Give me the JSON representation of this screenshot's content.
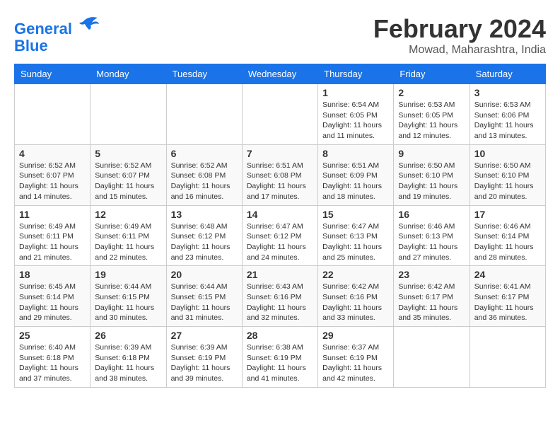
{
  "logo": {
    "line1": "General",
    "line2": "Blue"
  },
  "title": "February 2024",
  "location": "Mowad, Maharashtra, India",
  "headers": [
    "Sunday",
    "Monday",
    "Tuesday",
    "Wednesday",
    "Thursday",
    "Friday",
    "Saturday"
  ],
  "weeks": [
    [
      {
        "day": "",
        "info": ""
      },
      {
        "day": "",
        "info": ""
      },
      {
        "day": "",
        "info": ""
      },
      {
        "day": "",
        "info": ""
      },
      {
        "day": "1",
        "info": "Sunrise: 6:54 AM\nSunset: 6:05 PM\nDaylight: 11 hours and 11 minutes."
      },
      {
        "day": "2",
        "info": "Sunrise: 6:53 AM\nSunset: 6:05 PM\nDaylight: 11 hours and 12 minutes."
      },
      {
        "day": "3",
        "info": "Sunrise: 6:53 AM\nSunset: 6:06 PM\nDaylight: 11 hours and 13 minutes."
      }
    ],
    [
      {
        "day": "4",
        "info": "Sunrise: 6:52 AM\nSunset: 6:07 PM\nDaylight: 11 hours and 14 minutes."
      },
      {
        "day": "5",
        "info": "Sunrise: 6:52 AM\nSunset: 6:07 PM\nDaylight: 11 hours and 15 minutes."
      },
      {
        "day": "6",
        "info": "Sunrise: 6:52 AM\nSunset: 6:08 PM\nDaylight: 11 hours and 16 minutes."
      },
      {
        "day": "7",
        "info": "Sunrise: 6:51 AM\nSunset: 6:08 PM\nDaylight: 11 hours and 17 minutes."
      },
      {
        "day": "8",
        "info": "Sunrise: 6:51 AM\nSunset: 6:09 PM\nDaylight: 11 hours and 18 minutes."
      },
      {
        "day": "9",
        "info": "Sunrise: 6:50 AM\nSunset: 6:10 PM\nDaylight: 11 hours and 19 minutes."
      },
      {
        "day": "10",
        "info": "Sunrise: 6:50 AM\nSunset: 6:10 PM\nDaylight: 11 hours and 20 minutes."
      }
    ],
    [
      {
        "day": "11",
        "info": "Sunrise: 6:49 AM\nSunset: 6:11 PM\nDaylight: 11 hours and 21 minutes."
      },
      {
        "day": "12",
        "info": "Sunrise: 6:49 AM\nSunset: 6:11 PM\nDaylight: 11 hours and 22 minutes."
      },
      {
        "day": "13",
        "info": "Sunrise: 6:48 AM\nSunset: 6:12 PM\nDaylight: 11 hours and 23 minutes."
      },
      {
        "day": "14",
        "info": "Sunrise: 6:47 AM\nSunset: 6:12 PM\nDaylight: 11 hours and 24 minutes."
      },
      {
        "day": "15",
        "info": "Sunrise: 6:47 AM\nSunset: 6:13 PM\nDaylight: 11 hours and 25 minutes."
      },
      {
        "day": "16",
        "info": "Sunrise: 6:46 AM\nSunset: 6:13 PM\nDaylight: 11 hours and 27 minutes."
      },
      {
        "day": "17",
        "info": "Sunrise: 6:46 AM\nSunset: 6:14 PM\nDaylight: 11 hours and 28 minutes."
      }
    ],
    [
      {
        "day": "18",
        "info": "Sunrise: 6:45 AM\nSunset: 6:14 PM\nDaylight: 11 hours and 29 minutes."
      },
      {
        "day": "19",
        "info": "Sunrise: 6:44 AM\nSunset: 6:15 PM\nDaylight: 11 hours and 30 minutes."
      },
      {
        "day": "20",
        "info": "Sunrise: 6:44 AM\nSunset: 6:15 PM\nDaylight: 11 hours and 31 minutes."
      },
      {
        "day": "21",
        "info": "Sunrise: 6:43 AM\nSunset: 6:16 PM\nDaylight: 11 hours and 32 minutes."
      },
      {
        "day": "22",
        "info": "Sunrise: 6:42 AM\nSunset: 6:16 PM\nDaylight: 11 hours and 33 minutes."
      },
      {
        "day": "23",
        "info": "Sunrise: 6:42 AM\nSunset: 6:17 PM\nDaylight: 11 hours and 35 minutes."
      },
      {
        "day": "24",
        "info": "Sunrise: 6:41 AM\nSunset: 6:17 PM\nDaylight: 11 hours and 36 minutes."
      }
    ],
    [
      {
        "day": "25",
        "info": "Sunrise: 6:40 AM\nSunset: 6:18 PM\nDaylight: 11 hours and 37 minutes."
      },
      {
        "day": "26",
        "info": "Sunrise: 6:39 AM\nSunset: 6:18 PM\nDaylight: 11 hours and 38 minutes."
      },
      {
        "day": "27",
        "info": "Sunrise: 6:39 AM\nSunset: 6:19 PM\nDaylight: 11 hours and 39 minutes."
      },
      {
        "day": "28",
        "info": "Sunrise: 6:38 AM\nSunset: 6:19 PM\nDaylight: 11 hours and 41 minutes."
      },
      {
        "day": "29",
        "info": "Sunrise: 6:37 AM\nSunset: 6:19 PM\nDaylight: 11 hours and 42 minutes."
      },
      {
        "day": "",
        "info": ""
      },
      {
        "day": "",
        "info": ""
      }
    ]
  ]
}
